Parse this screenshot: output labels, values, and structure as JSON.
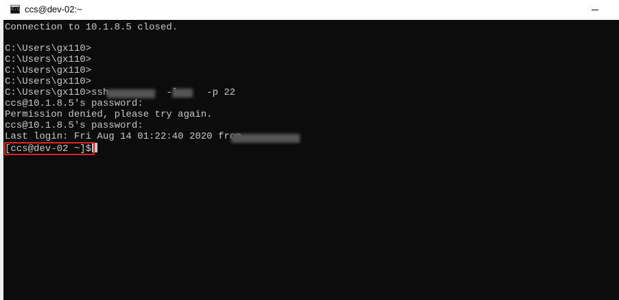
{
  "window": {
    "title": "ccs@dev-02:~",
    "icon": "console-icon",
    "icon_text": "C:\\"
  },
  "terminal": {
    "lines": [
      "Connection to 10.1.8.5 closed.",
      "C:\\Users\\gx110>",
      "C:\\Users\\gx110>",
      "C:\\Users\\gx110>",
      "C:\\Users\\gx110>",
      "C:\\Users\\gx110>ssh          -l     -p 22",
      "ccs@10.1.8.5's password:",
      "Permission denied, please try again.",
      "ccs@10.1.8.5's password:",
      "Last login: Fri Aug 14 01:22:40 2020 from",
      "[ccs@dev-02 ~]$"
    ]
  },
  "colors": {
    "background": "#0c0c0c",
    "foreground": "#c8c8c8",
    "highlight": "#e32222"
  }
}
